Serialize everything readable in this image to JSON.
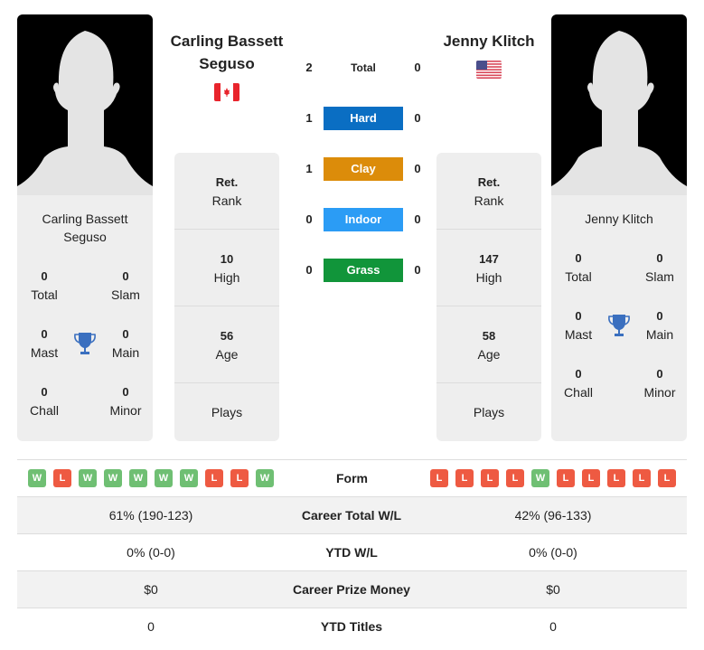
{
  "player1": {
    "name": "Carling Bassett Seguso",
    "country_flag": "canada-flag-icon",
    "titles": {
      "total": {
        "value": "0",
        "label": "Total"
      },
      "slam": {
        "value": "0",
        "label": "Slam"
      },
      "mast": {
        "value": "0",
        "label": "Mast"
      },
      "main": {
        "value": "0",
        "label": "Main"
      },
      "chall": {
        "value": "0",
        "label": "Chall"
      },
      "minor": {
        "value": "0",
        "label": "Minor"
      }
    },
    "info": {
      "rank": {
        "value": "Ret.",
        "label": "Rank"
      },
      "high": {
        "value": "10",
        "label": "High"
      },
      "age": {
        "value": "56",
        "label": "Age"
      },
      "plays": {
        "value": "",
        "label": "Plays"
      }
    },
    "form": [
      "W",
      "L",
      "W",
      "W",
      "W",
      "W",
      "W",
      "L",
      "L",
      "W"
    ],
    "career_total_wl": "61% (190-123)",
    "ytd_wl": "0% (0-0)",
    "career_prize_money": "$0",
    "ytd_titles": "0"
  },
  "player2": {
    "name": "Jenny Klitch",
    "country_flag": "usa-flag-icon",
    "titles": {
      "total": {
        "value": "0",
        "label": "Total"
      },
      "slam": {
        "value": "0",
        "label": "Slam"
      },
      "mast": {
        "value": "0",
        "label": "Mast"
      },
      "main": {
        "value": "0",
        "label": "Main"
      },
      "chall": {
        "value": "0",
        "label": "Chall"
      },
      "minor": {
        "value": "0",
        "label": "Minor"
      }
    },
    "info": {
      "rank": {
        "value": "Ret.",
        "label": "Rank"
      },
      "high": {
        "value": "147",
        "label": "High"
      },
      "age": {
        "value": "58",
        "label": "Age"
      },
      "plays": {
        "value": "",
        "label": "Plays"
      }
    },
    "form": [
      "L",
      "L",
      "L",
      "L",
      "W",
      "L",
      "L",
      "L",
      "L",
      "L"
    ],
    "career_total_wl": "42% (96-133)",
    "ytd_wl": "0% (0-0)",
    "career_prize_money": "$0",
    "ytd_titles": "0"
  },
  "h2h": [
    {
      "label": "Total",
      "p1": "2",
      "p2": "0",
      "color": ""
    },
    {
      "label": "Hard",
      "p1": "1",
      "p2": "0",
      "color": "#0a6ec3"
    },
    {
      "label": "Clay",
      "p1": "1",
      "p2": "0",
      "color": "#dc8c0a"
    },
    {
      "label": "Indoor",
      "p1": "0",
      "p2": "0",
      "color": "#2b9cf5"
    },
    {
      "label": "Grass",
      "p1": "0",
      "p2": "0",
      "color": "#11953a"
    }
  ],
  "comparison": {
    "form_label": "Form",
    "career_total_wl_label": "Career Total W/L",
    "ytd_wl_label": "YTD W/L",
    "career_prize_money_label": "Career Prize Money",
    "ytd_titles_label": "YTD Titles"
  },
  "colors": {
    "win": "#6fbf73",
    "loss": "#ee5a42",
    "trophy": "#3a6fbf"
  }
}
